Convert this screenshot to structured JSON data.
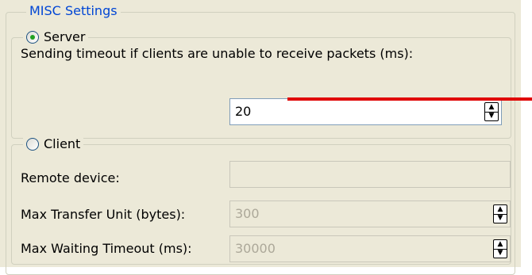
{
  "misc_group": {
    "title": "MISC Settings"
  },
  "server": {
    "label": "Server",
    "selected": true,
    "description": "Sending timeout if clients are unable to receive packets (ms):",
    "timeout_value": "20"
  },
  "client": {
    "label": "Client",
    "selected": false,
    "remote_device_label": "Remote device:",
    "remote_device_value": "",
    "mtu_label": "Max Transfer Unit (bytes):",
    "mtu_value": "300",
    "max_wait_label": "Max Waiting Timeout (ms):",
    "max_wait_value": "30000"
  },
  "annotation": {
    "color": "#e00000"
  }
}
